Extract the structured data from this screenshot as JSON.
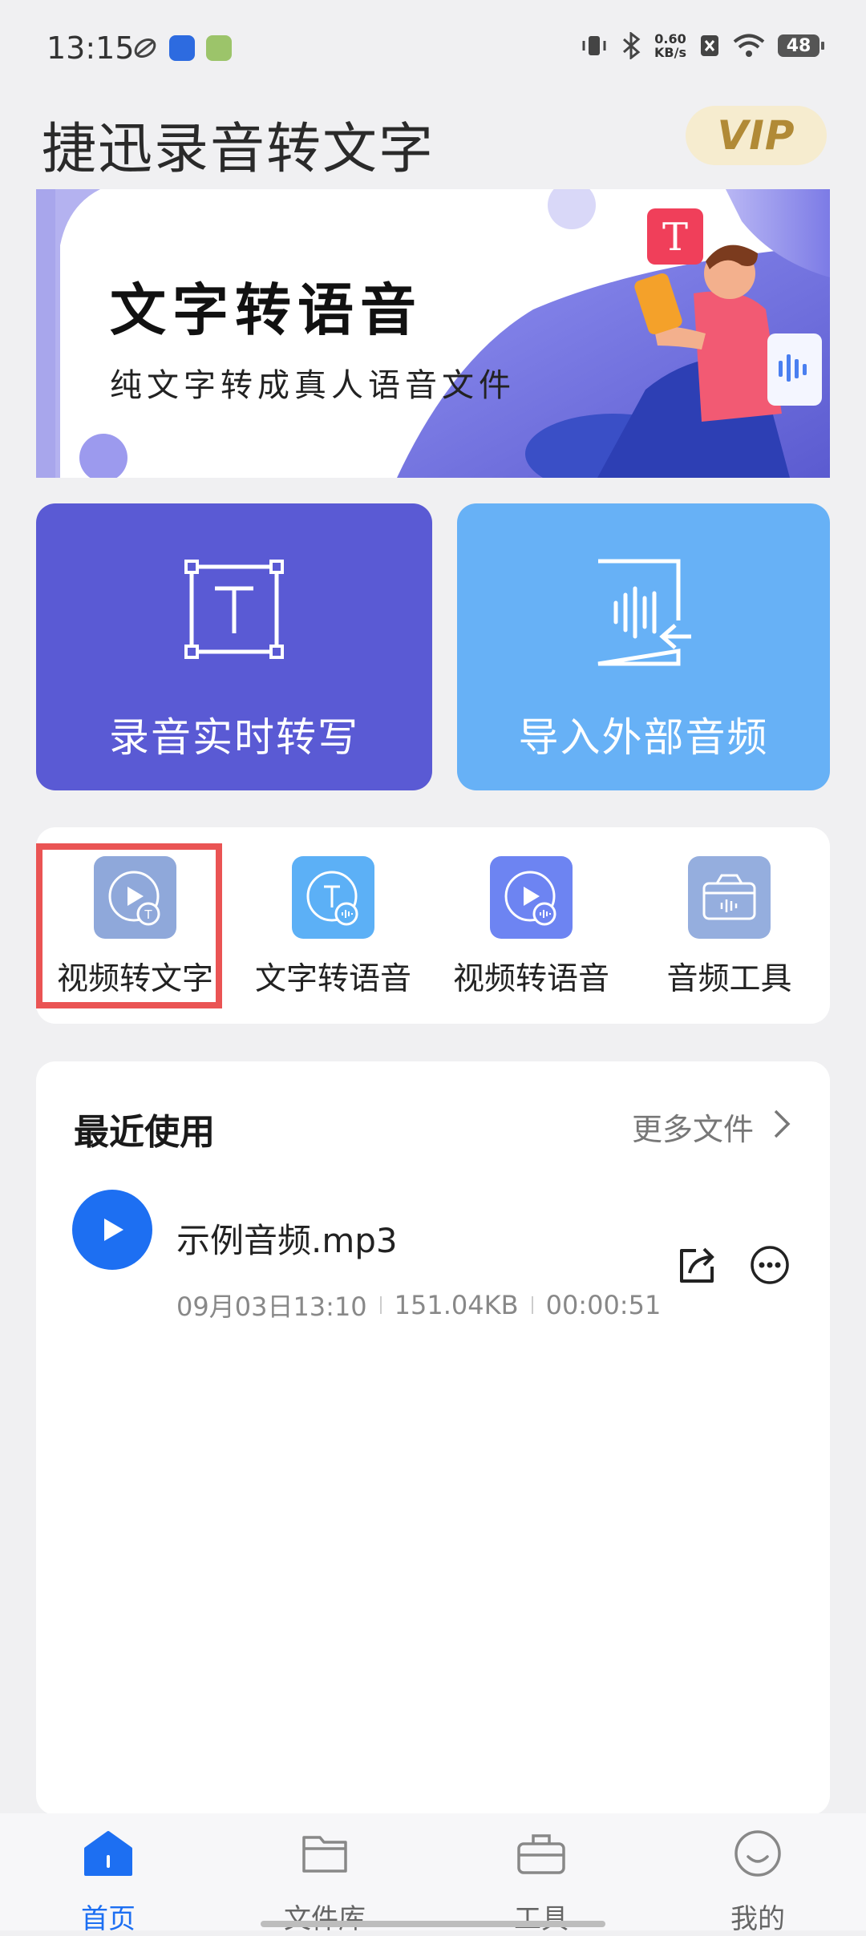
{
  "status": {
    "time": "13:15",
    "net_speed_value": "0.60",
    "net_speed_unit": "KB/s",
    "battery": "48"
  },
  "header": {
    "title": "捷迅录音转文字",
    "vip_label": "VIP"
  },
  "banner": {
    "title": "文字转语音",
    "subtitle": "纯文字转成真人语音文件"
  },
  "big_cards": [
    {
      "label": "录音实时转写",
      "color": "#5a5ad4"
    },
    {
      "label": "导入外部音频",
      "color": "#67b1f6"
    }
  ],
  "tools": [
    {
      "label": "视频转文字",
      "icon": "video-to-text-icon",
      "color": "#8fa8da",
      "highlighted": true
    },
    {
      "label": "文字转语音",
      "icon": "text-to-speech-icon",
      "color": "#5cb0f6"
    },
    {
      "label": "视频转语音",
      "icon": "video-to-speech-icon",
      "color": "#6d84f2"
    },
    {
      "label": "音频工具",
      "icon": "audio-toolbox-icon",
      "color": "#95aede"
    }
  ],
  "recent": {
    "title": "最近使用",
    "more_label": "更多文件",
    "files": [
      {
        "name": "示例音频.mp3",
        "date": "09月03日13:10",
        "size": "151.04KB",
        "duration": "00:00:51"
      }
    ]
  },
  "bottom_nav": [
    {
      "label": "首页",
      "icon": "home-icon",
      "active": true
    },
    {
      "label": "文件库",
      "icon": "folder-icon",
      "active": false
    },
    {
      "label": "工具",
      "icon": "toolbox-icon",
      "active": false
    },
    {
      "label": "我的",
      "icon": "profile-icon",
      "active": false
    }
  ],
  "colors": {
    "accent": "#1d6ff2",
    "highlight_border": "#ea5454"
  }
}
